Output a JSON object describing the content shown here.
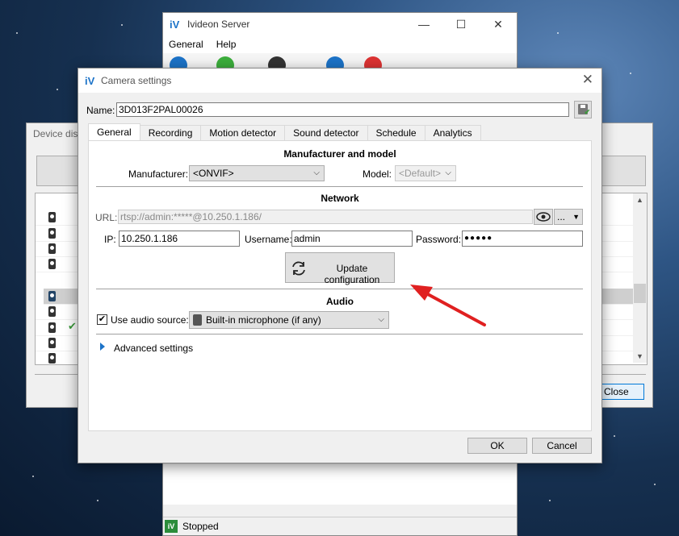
{
  "ivideon_server": {
    "title": "Ivideon Server",
    "menu": [
      "General",
      "Help"
    ],
    "window_controls": {
      "minimize": "—",
      "maximize": "☐",
      "close": "✕"
    },
    "status": "Stopped",
    "logo_text": "iV"
  },
  "device_discovery": {
    "title": "Device disc",
    "close_label": "Close",
    "rows": 10,
    "selected_row": 5,
    "checked_row": 7
  },
  "camera_settings": {
    "title": "Camera settings",
    "close_glyph": "✕",
    "name_label": "Name:",
    "name_value": "3D013F2PAL00026",
    "tabs": [
      "General",
      "Recording",
      "Motion detector",
      "Sound detector",
      "Schedule",
      "Analytics"
    ],
    "active_tab": "General",
    "manufacturer_section": "Manufacturer and model",
    "manufacturer_label": "Manufacturer:",
    "manufacturer_value": "<ONVIF>",
    "model_label": "Model:",
    "model_value": "<Default>",
    "network_section": "Network",
    "url_label": "URL:",
    "url_value": "rtsp://admin:*****@10.250.1.186/",
    "url_more": "...",
    "ip_label": "IP:",
    "ip_value": "10.250.1.186",
    "username_label": "Username:",
    "username_value": "admin",
    "password_label": "Password:",
    "password_value": "●●●●●",
    "update_button": "Update configuration",
    "audio_section": "Audio",
    "use_audio_label": "Use audio source:",
    "use_audio_checked": "✔",
    "audio_source_value": "Built-in microphone (if any)",
    "advanced_label": "Advanced settings",
    "ok_label": "OK",
    "cancel_label": "Cancel"
  },
  "colors": {
    "annotation_arrow": "#e02020",
    "accent": "#0078d7"
  }
}
